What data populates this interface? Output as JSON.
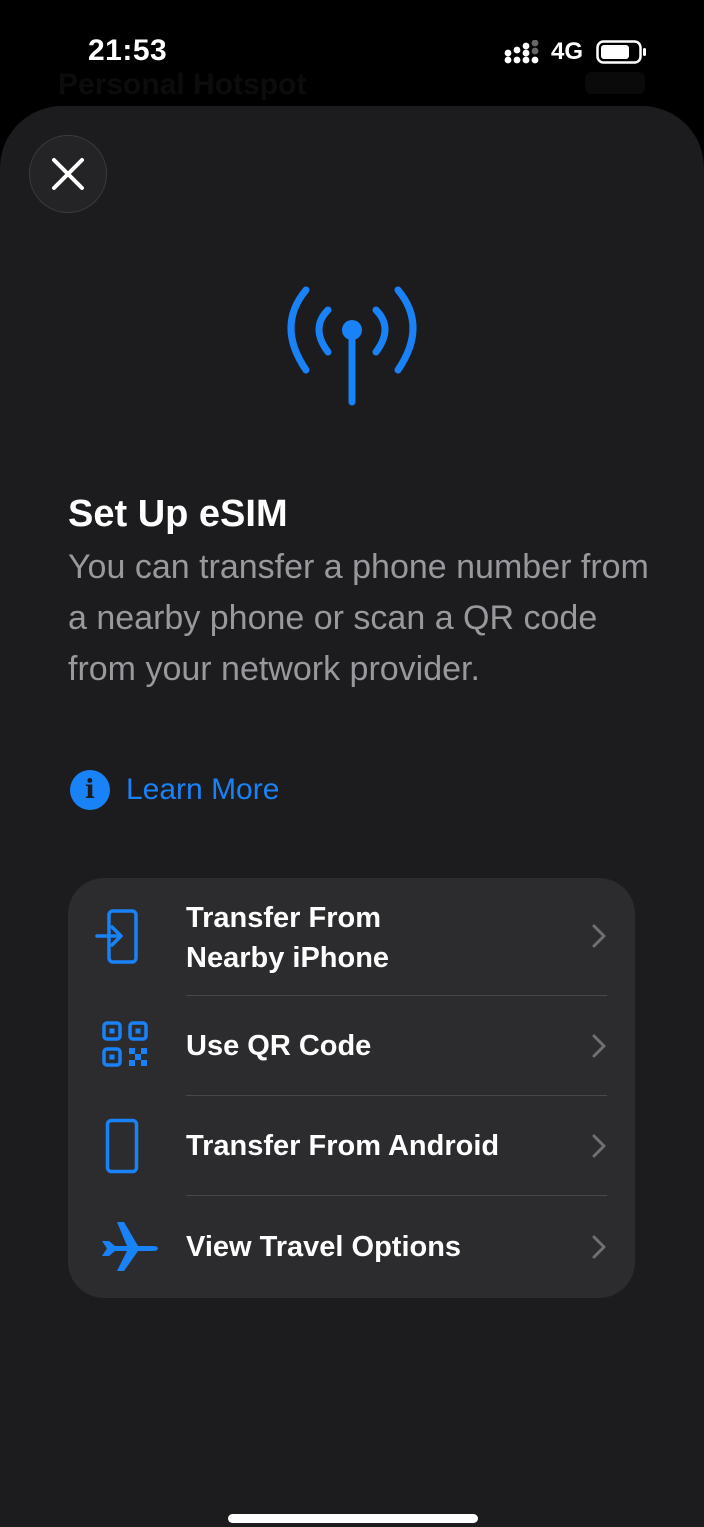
{
  "status_bar": {
    "time": "21:53",
    "network": "4G",
    "signal_icon": "signal-dots-icon",
    "battery_icon": "battery-icon"
  },
  "background": {
    "title": "Personal Hotspot"
  },
  "sheet": {
    "close_icon": "close-icon",
    "hero_icon": "antenna-icon",
    "title": "Set Up eSIM",
    "description": "You can transfer a phone number from a nearby phone or scan a QR code from your network provider.",
    "learn_more": "Learn More",
    "options": [
      {
        "label_line1": "Transfer From",
        "label_line2": "Nearby iPhone",
        "icon": "transfer-in-icon"
      },
      {
        "label": "Use QR Code",
        "icon": "qr-code-icon"
      },
      {
        "label": "Transfer From Android",
        "icon": "phone-icon"
      },
      {
        "label": "View Travel Options",
        "icon": "airplane-icon"
      }
    ]
  },
  "colors": {
    "accent": "#1a82f7",
    "sheet_bg": "#1c1c1e",
    "card_bg": "#2c2c2e",
    "secondary_text": "#98989d"
  }
}
